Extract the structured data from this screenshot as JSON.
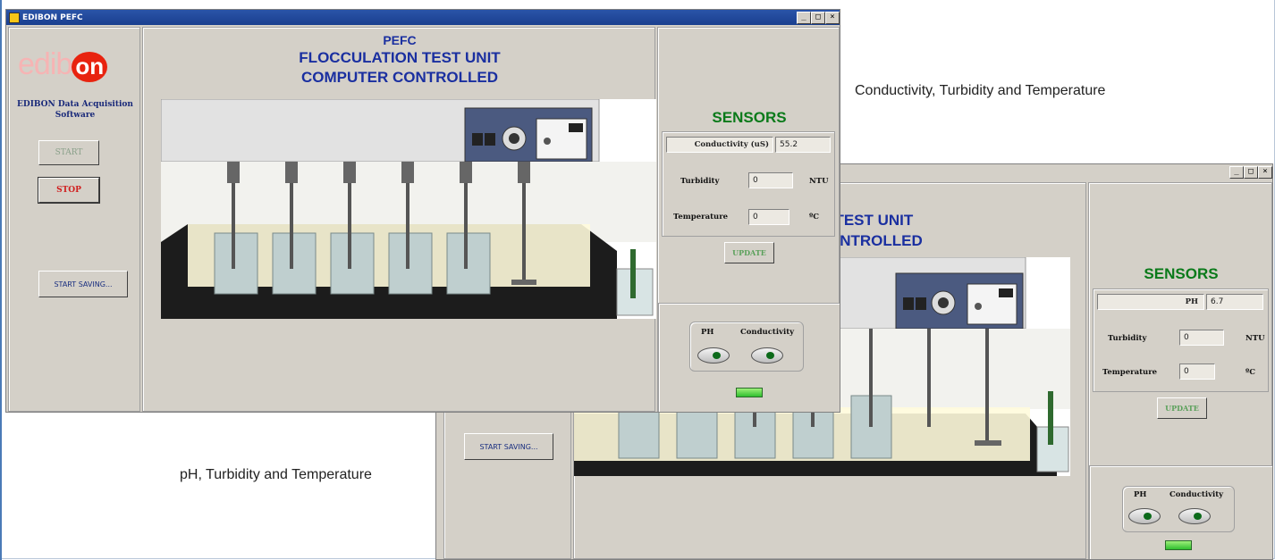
{
  "captions": {
    "top": "Conductivity, Turbidity and  Temperature",
    "bottom": "pH, Turbidity and Temperature"
  },
  "window1": {
    "title": "EDIBON PEFC",
    "window_buttons": [
      "_",
      "□",
      "×"
    ],
    "logo": "edibon",
    "software_label": "EDIBON Data Acquisition Software",
    "buttons": {
      "start": "START",
      "stop": "STOP",
      "start_saving": "START SAVING..."
    },
    "heading": [
      "PEFC",
      "FLOCCULATION TEST UNIT",
      "COMPUTER CONTROLLED"
    ],
    "sensors": {
      "title": "SENSORS",
      "primary_label": "Conductivity (uS)",
      "primary_value": "55.2",
      "turbidity_label": "Turbidity",
      "turbidity_value": "0",
      "turbidity_unit": "NTU",
      "temperature_label": "Temperature",
      "temperature_value": "0",
      "temperature_unit": "ºC",
      "update": "UPDATE"
    },
    "selector": {
      "ph": "PH",
      "conductivity": "Conductivity"
    }
  },
  "window2": {
    "window_buttons": [
      "_",
      "□",
      "×"
    ],
    "heading_partial": [
      "C",
      "I TEST UNIT",
      "ONTROLLED"
    ],
    "buttons": {
      "start_saving": "START SAVING..."
    },
    "sensors": {
      "title": "SENSORS",
      "primary_label": "PH",
      "primary_value": "6.7",
      "turbidity_label": "Turbidity",
      "turbidity_value": "0",
      "turbidity_unit": "NTU",
      "temperature_label": "Temperature",
      "temperature_value": "0",
      "temperature_unit": "ºC",
      "update": "UPDATE"
    },
    "selector": {
      "ph": "PH",
      "conductivity": "Conductivity"
    }
  },
  "colors": {
    "title_blue": "#1a2fa0",
    "sensors_green": "#0a7a1a",
    "stop_red": "#d02020",
    "logo_red": "#e8230f"
  }
}
